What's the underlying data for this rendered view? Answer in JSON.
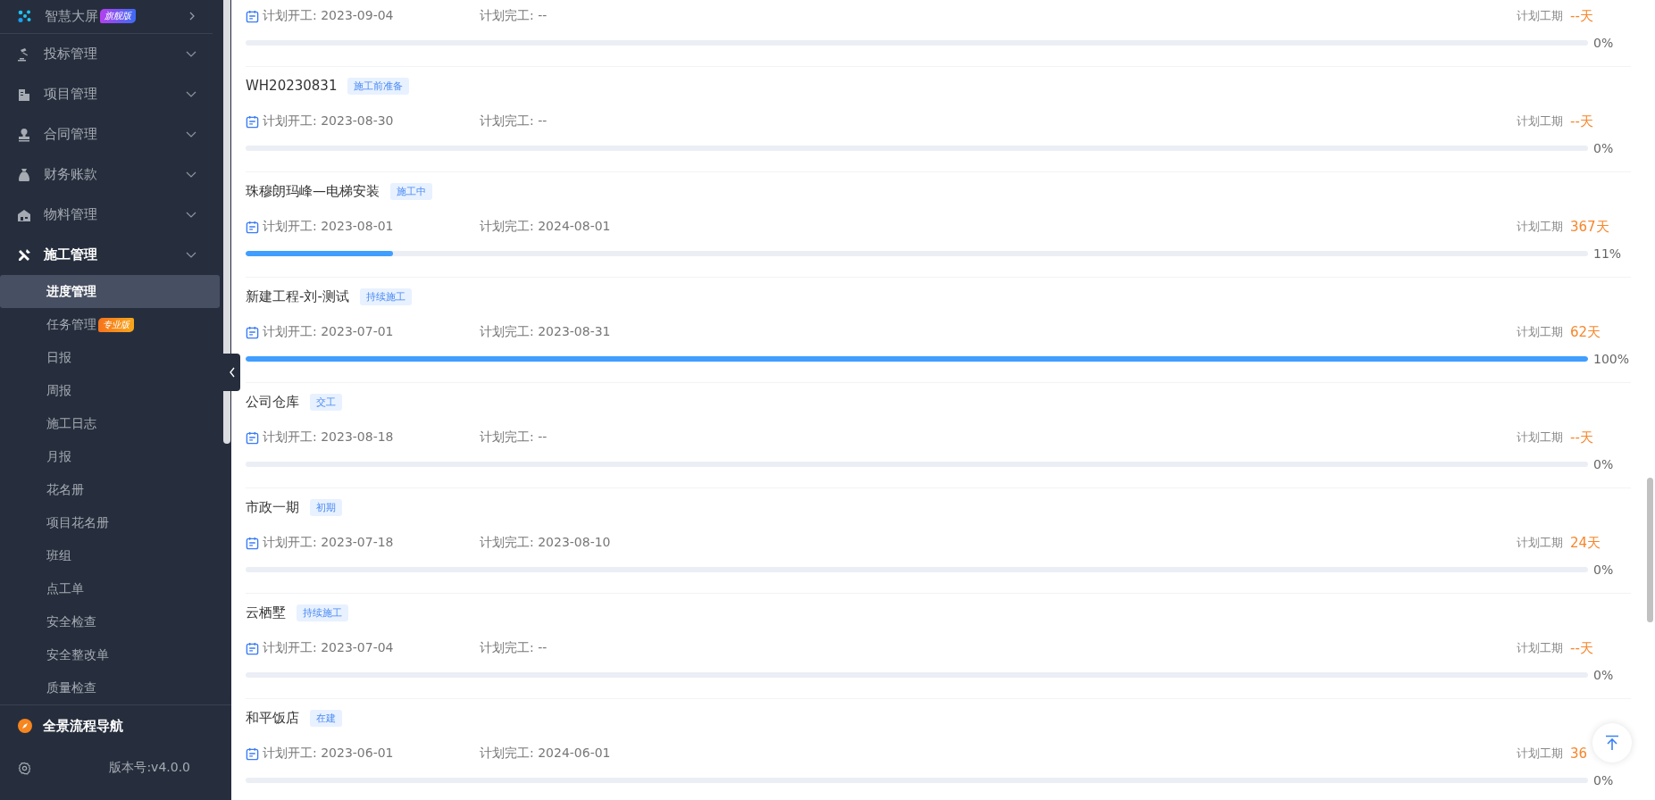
{
  "sidebar": {
    "top_item": {
      "label": "智慧大屏",
      "badge": "旗舰版"
    },
    "groups": [
      {
        "label": "投标管理",
        "expanded": false
      },
      {
        "label": "项目管理",
        "expanded": false
      },
      {
        "label": "合同管理",
        "expanded": false
      },
      {
        "label": "财务账款",
        "expanded": false
      },
      {
        "label": "物料管理",
        "expanded": false
      },
      {
        "label": "施工管理",
        "expanded": true
      }
    ],
    "sub_items": [
      {
        "label": "进度管理",
        "selected": true
      },
      {
        "label": "任务管理",
        "selected": false,
        "badge": "专业版"
      },
      {
        "label": "日报",
        "selected": false
      },
      {
        "label": "周报",
        "selected": false
      },
      {
        "label": "施工日志",
        "selected": false
      },
      {
        "label": "月报",
        "selected": false
      },
      {
        "label": "花名册",
        "selected": false
      },
      {
        "label": "项目花名册",
        "selected": false
      },
      {
        "label": "班组",
        "selected": false
      },
      {
        "label": "点工单",
        "selected": false
      },
      {
        "label": "安全检查",
        "selected": false
      },
      {
        "label": "安全整改单",
        "selected": false
      },
      {
        "label": "质量检查",
        "selected": false
      }
    ],
    "navigator": "全景流程导航",
    "version": "版本号:v4.0.0"
  },
  "projects": [
    {
      "start": "计划开工: 2023-09-04",
      "end": "计划完工: --",
      "duration_label": "计划工期",
      "duration": "--天",
      "level": 0,
      "percent": "0%"
    },
    {
      "title": "WH20230831",
      "tag": "施工前准备",
      "start": "计划开工: 2023-08-30",
      "end": "计划完工: --",
      "duration_label": "计划工期",
      "duration": "--天",
      "level": 0,
      "percent": "0%"
    },
    {
      "title": "珠穆朗玛峰—电梯安装",
      "tag": "施工中",
      "start": "计划开工: 2023-08-01",
      "end": "计划完工: 2024-08-01",
      "duration_label": "计划工期",
      "duration": "367天",
      "level": 0.11,
      "percent": "11%"
    },
    {
      "title": "新建工程-刘-测试",
      "tag": "持续施工",
      "start": "计划开工: 2023-07-01",
      "end": "计划完工: 2023-08-31",
      "duration_label": "计划工期",
      "duration": "62天",
      "level": 1,
      "percent": "100%"
    },
    {
      "title": "公司仓库",
      "tag": "交工",
      "start": "计划开工: 2023-08-18",
      "end": "计划完工: --",
      "duration_label": "计划工期",
      "duration": "--天",
      "level": 0,
      "percent": "0%"
    },
    {
      "title": "市政一期",
      "tag": "初期",
      "start": "计划开工: 2023-07-18",
      "end": "计划完工: 2023-08-10",
      "duration_label": "计划工期",
      "duration": "24天",
      "level": 0,
      "percent": "0%"
    },
    {
      "title": "云栖墅",
      "tag": "持续施工",
      "start": "计划开工: 2023-07-04",
      "end": "计划完工: --",
      "duration_label": "计划工期",
      "duration": "--天",
      "level": 0,
      "percent": "0%"
    },
    {
      "title": "和平饭店",
      "tag": "在建",
      "start": "计划开工: 2023-06-01",
      "end": "计划完工: 2024-06-01",
      "duration_label": "计划工期",
      "duration": "36",
      "level": 0,
      "percent": "0%"
    }
  ]
}
